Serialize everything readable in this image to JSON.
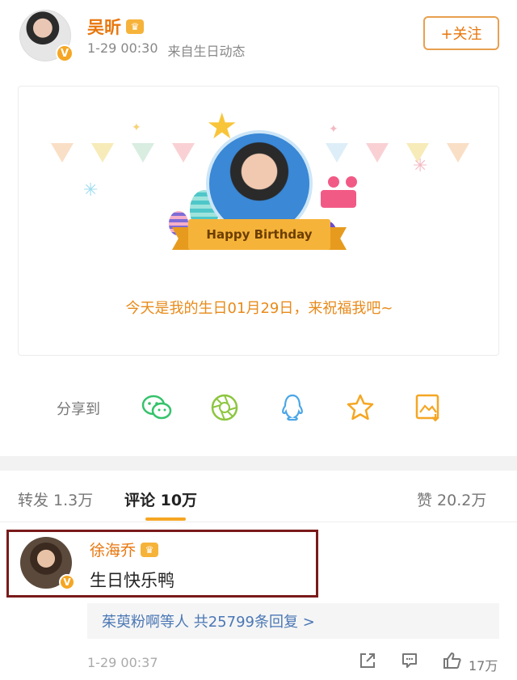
{
  "post": {
    "author": "吴昕",
    "vip_badge": "♛",
    "verified_badge": "V",
    "time": "1-29 00:30",
    "source": "来自生日动态",
    "follow_label": "+关注"
  },
  "card": {
    "banner_text": "Happy Birthday",
    "caption": "今天是我的生日01月29日，来祝福我吧~"
  },
  "share": {
    "label": "分享到",
    "icons": [
      "wechat-icon",
      "moments-icon",
      "qq-icon",
      "favorite-star-icon",
      "image-save-icon"
    ]
  },
  "tabs": {
    "repost": "转发 1.3万",
    "comments": "评论 10万",
    "likes": "赞 20.2万"
  },
  "comment": {
    "author": "徐海乔",
    "vip_badge": "♛",
    "verified_badge": "V",
    "text": "生日快乐鸭",
    "replies_text": "茱萸粉啊等人 共25799条回复 >",
    "time": "1-29 00:37",
    "like_count": "17万"
  },
  "colors": {
    "accent": "#e8760c",
    "badge": "#f5a623",
    "highlight_border": "#7a1a1a",
    "link": "#4a77b5"
  }
}
